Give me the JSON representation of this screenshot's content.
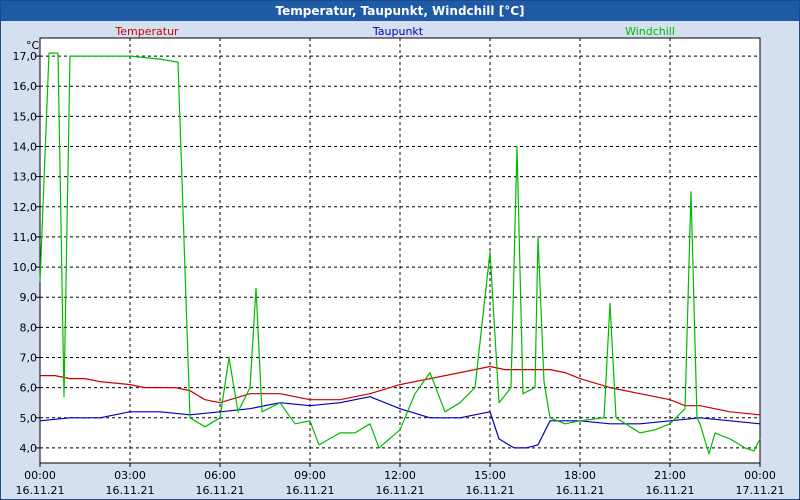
{
  "window": {
    "title": "Temperatur, Taupunkt, Windchill [°C]"
  },
  "chart_data": {
    "type": "line",
    "title": "Temperatur, Taupunkt, Windchill [°C]",
    "ylabel": "°C",
    "xlabel": "",
    "ylim": [
      3.5,
      17.6
    ],
    "xlim": [
      0,
      24
    ],
    "grid": true,
    "legend_placement": "top",
    "y_ticks": [
      "4,0",
      "5,0",
      "6,0",
      "7,0",
      "8,0",
      "9,0",
      "10,0",
      "11,0",
      "12,0",
      "13,0",
      "14,0",
      "15,0",
      "16,0",
      "17,0"
    ],
    "y_tick_values": [
      4,
      5,
      6,
      7,
      8,
      9,
      10,
      11,
      12,
      13,
      14,
      15,
      16,
      17
    ],
    "x_ticks": [
      {
        "time": "00:00",
        "date": "16.11.21",
        "hour": 0
      },
      {
        "time": "03:00",
        "date": "16.11.21",
        "hour": 3
      },
      {
        "time": "06:00",
        "date": "16.11.21",
        "hour": 6
      },
      {
        "time": "09:00",
        "date": "16.11.21",
        "hour": 9
      },
      {
        "time": "12:00",
        "date": "16.11.21",
        "hour": 12
      },
      {
        "time": "15:00",
        "date": "16.11.21",
        "hour": 15
      },
      {
        "time": "18:00",
        "date": "16.11.21",
        "hour": 18
      },
      {
        "time": "21:00",
        "date": "16.11.21",
        "hour": 21
      },
      {
        "time": "00:00",
        "date": "17.11.21",
        "hour": 24
      }
    ],
    "series": [
      {
        "name": "Temperatur",
        "color": "#cc0000",
        "points": [
          [
            0,
            6.4
          ],
          [
            0.5,
            6.4
          ],
          [
            1,
            6.3
          ],
          [
            1.5,
            6.3
          ],
          [
            2,
            6.2
          ],
          [
            3,
            6.1
          ],
          [
            3.5,
            6.0
          ],
          [
            4.5,
            6.0
          ],
          [
            5,
            5.9
          ],
          [
            5.5,
            5.6
          ],
          [
            6,
            5.5
          ],
          [
            7,
            5.8
          ],
          [
            8,
            5.8
          ],
          [
            9,
            5.6
          ],
          [
            10,
            5.6
          ],
          [
            11,
            5.8
          ],
          [
            12,
            6.1
          ],
          [
            13,
            6.3
          ],
          [
            14,
            6.5
          ],
          [
            15,
            6.7
          ],
          [
            15.5,
            6.6
          ],
          [
            16,
            6.6
          ],
          [
            17,
            6.6
          ],
          [
            17.5,
            6.5
          ],
          [
            18,
            6.3
          ],
          [
            19,
            6.0
          ],
          [
            20,
            5.8
          ],
          [
            21,
            5.6
          ],
          [
            21.5,
            5.4
          ],
          [
            22,
            5.4
          ],
          [
            23,
            5.2
          ],
          [
            24,
            5.1
          ]
        ]
      },
      {
        "name": "Taupunkt",
        "color": "#0000bb",
        "points": [
          [
            0,
            4.9
          ],
          [
            1,
            5.0
          ],
          [
            2,
            5.0
          ],
          [
            3,
            5.2
          ],
          [
            4,
            5.2
          ],
          [
            5,
            5.1
          ],
          [
            6,
            5.2
          ],
          [
            7,
            5.3
          ],
          [
            8,
            5.5
          ],
          [
            9,
            5.4
          ],
          [
            10,
            5.5
          ],
          [
            11,
            5.7
          ],
          [
            12,
            5.3
          ],
          [
            13,
            5.0
          ],
          [
            14,
            5.0
          ],
          [
            15,
            5.2
          ],
          [
            15.3,
            4.3
          ],
          [
            15.8,
            4.0
          ],
          [
            16.2,
            4.0
          ],
          [
            16.6,
            4.1
          ],
          [
            17,
            4.9
          ],
          [
            18,
            4.9
          ],
          [
            19,
            4.8
          ],
          [
            20,
            4.8
          ],
          [
            21,
            4.9
          ],
          [
            22,
            5.0
          ],
          [
            23,
            4.9
          ],
          [
            24,
            4.8
          ]
        ]
      },
      {
        "name": "Windchill",
        "color": "#00bb00",
        "points": [
          [
            0,
            9.5
          ],
          [
            0.3,
            17.1
          ],
          [
            0.6,
            17.1
          ],
          [
            0.8,
            5.7
          ],
          [
            1,
            17.0
          ],
          [
            1.3,
            17.0
          ],
          [
            2,
            17.0
          ],
          [
            3,
            17.0
          ],
          [
            4,
            16.9
          ],
          [
            4.6,
            16.8
          ],
          [
            5,
            5.0
          ],
          [
            5.5,
            4.7
          ],
          [
            6,
            5.0
          ],
          [
            6.3,
            7.0
          ],
          [
            6.6,
            5.2
          ],
          [
            7,
            6.0
          ],
          [
            7.2,
            9.3
          ],
          [
            7.4,
            5.2
          ],
          [
            8,
            5.5
          ],
          [
            8.5,
            4.8
          ],
          [
            9,
            4.9
          ],
          [
            9.3,
            4.1
          ],
          [
            10,
            4.5
          ],
          [
            10.5,
            4.5
          ],
          [
            11,
            4.8
          ],
          [
            11.3,
            4.0
          ],
          [
            12,
            4.6
          ],
          [
            12.5,
            5.8
          ],
          [
            13,
            6.5
          ],
          [
            13.5,
            5.2
          ],
          [
            14,
            5.5
          ],
          [
            14.5,
            6.0
          ],
          [
            15,
            10.5
          ],
          [
            15.3,
            5.5
          ],
          [
            15.7,
            6.0
          ],
          [
            15.9,
            14.0
          ],
          [
            16.1,
            5.8
          ],
          [
            16.5,
            6.0
          ],
          [
            16.6,
            11.0
          ],
          [
            16.8,
            6.2
          ],
          [
            17,
            5.0
          ],
          [
            17.5,
            4.8
          ],
          [
            18,
            4.9
          ],
          [
            18.8,
            5.0
          ],
          [
            19,
            8.8
          ],
          [
            19.2,
            5.0
          ],
          [
            20,
            4.5
          ],
          [
            20.5,
            4.6
          ],
          [
            21,
            4.8
          ],
          [
            21.5,
            5.3
          ],
          [
            21.7,
            12.5
          ],
          [
            21.9,
            5.0
          ],
          [
            22,
            4.8
          ],
          [
            22.3,
            3.8
          ],
          [
            22.5,
            4.5
          ],
          [
            23,
            4.3
          ],
          [
            23.5,
            4.0
          ],
          [
            23.8,
            3.9
          ],
          [
            24,
            4.3
          ]
        ]
      }
    ]
  }
}
